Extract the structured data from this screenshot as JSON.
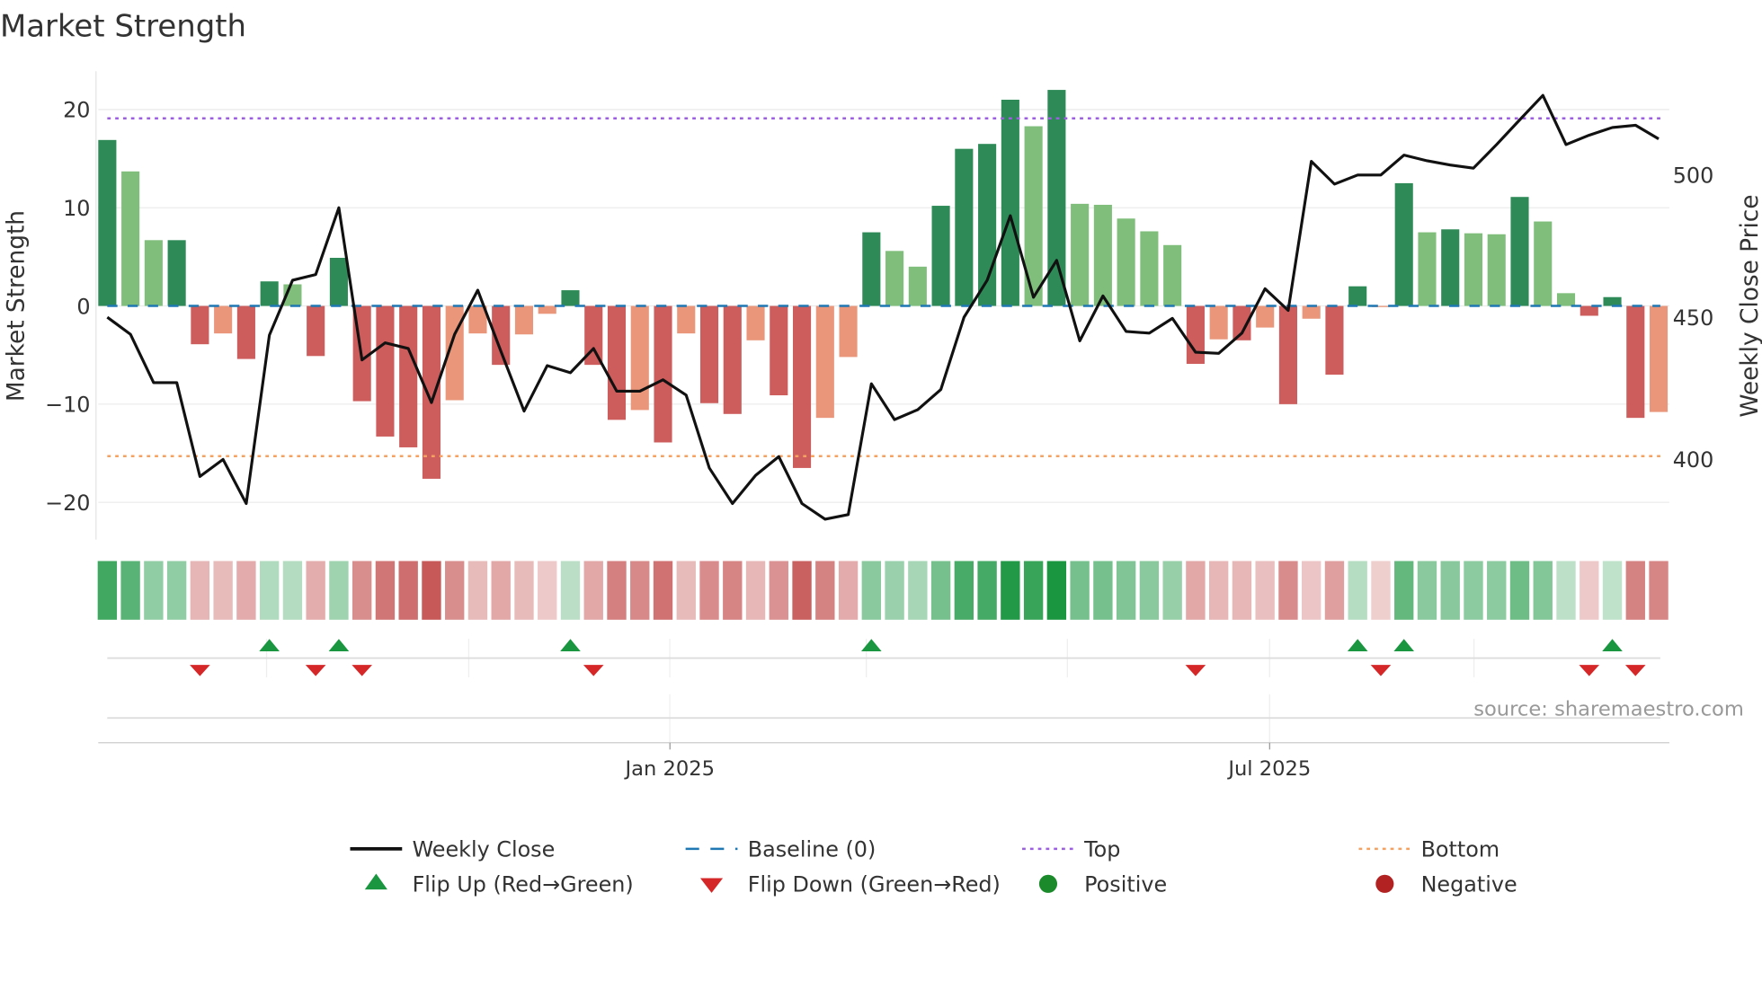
{
  "chart_data": {
    "type": "bar",
    "title": "Market Strength",
    "ylabel": "Market Strength",
    "y2label": "Weekly Close Price",
    "ylim": [
      -23.5,
      24.2
    ],
    "y2lim": [
      373,
      537
    ],
    "yticks": [
      20,
      10,
      0,
      -10,
      -20
    ],
    "ytick_labels": [
      "20",
      "10",
      "0",
      "−10",
      "−20"
    ],
    "y2ticks": [
      500,
      450,
      400
    ],
    "y2tick_labels": [
      "500",
      "450",
      "400"
    ],
    "xticks": [
      {
        "label": "Jan 2025",
        "index": 24.3
      },
      {
        "label": "Jul 2025",
        "index": 50.2
      }
    ],
    "top_level": 19.1,
    "bottom_level": -15.3,
    "baseline": 0,
    "strength": [
      16.9,
      13.7,
      6.7,
      6.7,
      -3.9,
      -2.8,
      -5.4,
      2.5,
      2.2,
      -5.1,
      4.9,
      -9.7,
      -13.3,
      -14.4,
      -17.6,
      -9.6,
      -2.8,
      -6.0,
      -2.9,
      -0.8,
      1.6,
      -6.0,
      -11.6,
      -10.6,
      -13.9,
      -2.8,
      -9.9,
      -11.0,
      -3.5,
      -9.1,
      -16.5,
      -11.4,
      -5.2,
      7.5,
      5.6,
      4.0,
      10.2,
      16.0,
      16.5,
      21.0,
      18.3,
      22.0,
      10.4,
      10.3,
      8.9,
      7.6,
      6.2,
      -5.9,
      -3.4,
      -3.5,
      -2.2,
      -10.0,
      -1.3,
      -7.0,
      2.0,
      -0.1,
      12.5,
      7.5,
      7.8,
      7.4,
      7.3,
      11.1,
      8.6,
      1.3,
      -1.0,
      0.9,
      -11.4,
      -10.8
    ],
    "shade": [
      "d",
      "l",
      "l",
      "d",
      "d",
      "l",
      "d",
      "d",
      "l",
      "d",
      "d",
      "d",
      "d",
      "d",
      "d",
      "l",
      "l",
      "d",
      "l",
      "l",
      "d",
      "d",
      "d",
      "l",
      "d",
      "l",
      "d",
      "d",
      "l",
      "d",
      "d",
      "l",
      "l",
      "d",
      "l",
      "l",
      "d",
      "d",
      "d",
      "d",
      "l",
      "d",
      "l",
      "l",
      "l",
      "l",
      "l",
      "d",
      "l",
      "d",
      "l",
      "d",
      "l",
      "d",
      "d",
      "l",
      "d",
      "l",
      "d",
      "l",
      "l",
      "d",
      "l",
      "l",
      "d",
      "d",
      "d",
      "l"
    ],
    "weekly_close": [
      450,
      444,
      427,
      427,
      394,
      400,
      384.5,
      443.7,
      463,
      465,
      488.5,
      435,
      441,
      439,
      420,
      444,
      459.5,
      438,
      417,
      433,
      430.5,
      439,
      424,
      424,
      428,
      422.6,
      397,
      384.5,
      394.4,
      401,
      384.5,
      379,
      380.6,
      426.6,
      414,
      417.5,
      424.6,
      450,
      463,
      485.7,
      457,
      470,
      441.7,
      457.5,
      445,
      444.4,
      449.6,
      437.7,
      437.3,
      444.4,
      460,
      452.4,
      504.8,
      496.8,
      500,
      500,
      507,
      505,
      503.5,
      502.4,
      510.7,
      519.4,
      528,
      510.7,
      514,
      516.7,
      517.5,
      512.7
    ],
    "flip_up_indices": [
      7,
      10,
      20,
      33,
      54,
      56,
      65
    ],
    "flip_down_indices": [
      4,
      9,
      11,
      21,
      47,
      55,
      64,
      66
    ],
    "legend": [
      {
        "label": "Weekly Close",
        "kind": "line",
        "color": "#111111"
      },
      {
        "label": "Baseline (0)",
        "kind": "dash",
        "color": "#1f77b4"
      },
      {
        "label": "Top",
        "kind": "dot",
        "color": "#9b5fe0"
      },
      {
        "label": "Bottom",
        "kind": "dot",
        "color": "#f4a261"
      },
      {
        "label": "Flip Up (Red→Green)",
        "kind": "tri-up",
        "color": "#1a9641"
      },
      {
        "label": "Flip Down (Green→Red)",
        "kind": "tri-down",
        "color": "#d62728"
      },
      {
        "label": "Positive",
        "kind": "circle",
        "color": "#1a8a2a"
      },
      {
        "label": "Negative",
        "kind": "circle",
        "color": "#b22222"
      }
    ],
    "legend_placement": "bottom"
  },
  "colors": {
    "pos_dark": "#2e8b57",
    "pos_light": "#7fbf7b",
    "neg_dark": "#cd5c5c",
    "neg_light": "#e9967a",
    "line": "#111111",
    "top": "#9b5fe0",
    "bottom": "#f4a261",
    "baseline": "#1f77b4"
  },
  "source": "source: sharemaestro.com"
}
